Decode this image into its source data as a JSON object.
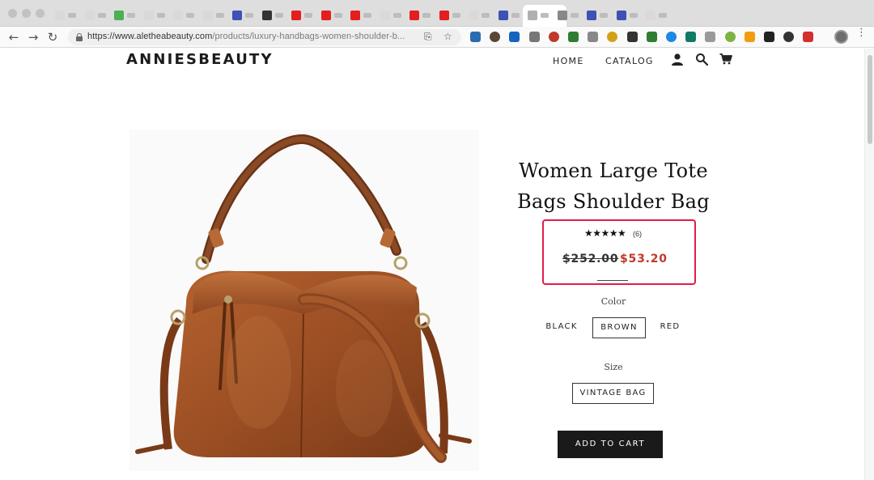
{
  "browser": {
    "url_main": "https://www.aletheabeauty.com",
    "url_rest": "/products/luxury-handbags-women-shoulder-b...",
    "tab_colors": [
      "#d9d9d9",
      "#d9d9d9",
      "#4caf50",
      "#d9d9d9",
      "#d9d9d9",
      "#d9d9d9",
      "#3f51b5",
      "#333333",
      "#e41e1e",
      "#e41e1e",
      "#e41e1e",
      "#d9d9d9",
      "#e41e1e",
      "#e41e1e",
      "#d9d9d9",
      "#3f51b5",
      "#ffffff",
      "#888888",
      "#3f51b5",
      "#3f51b5",
      "#d9d9d9"
    ],
    "extension_icons": [
      "flag-icon",
      "circle-icon",
      "target-icon",
      "note-icon",
      "store-icon",
      "leaf-icon",
      "moon-icon",
      "gem-icon",
      "js-icon",
      "bars-icon",
      "check-icon",
      "square-icon",
      "magnifier-icon",
      "puzzle-icon",
      "key-icon",
      "a-icon",
      "dot-icon",
      "record-icon"
    ]
  },
  "store": {
    "logo": "ANNIESBEAUTY",
    "nav": {
      "home": "HOME",
      "catalog": "CATALOG"
    }
  },
  "product": {
    "title_line1": "Women Large Tote",
    "title_line2": "Bags Shoulder Bag",
    "rating_stars": "★★★★★",
    "rating_value": 5,
    "review_count": "(6)",
    "price_old": "$252.00",
    "price_new": "$53.20",
    "color_label": "Color",
    "colors": [
      "BLACK",
      "BROWN",
      "RED"
    ],
    "selected_color": "BROWN",
    "size_label": "Size",
    "size_option": "VINTAGE BAG",
    "add_to_cart": "ADD TO CART"
  },
  "colors": {
    "sale_price": "#c0392b",
    "highlight_border": "#e11d48",
    "button_bg": "#1a1a1a",
    "bag_leather": "#a0522d"
  }
}
